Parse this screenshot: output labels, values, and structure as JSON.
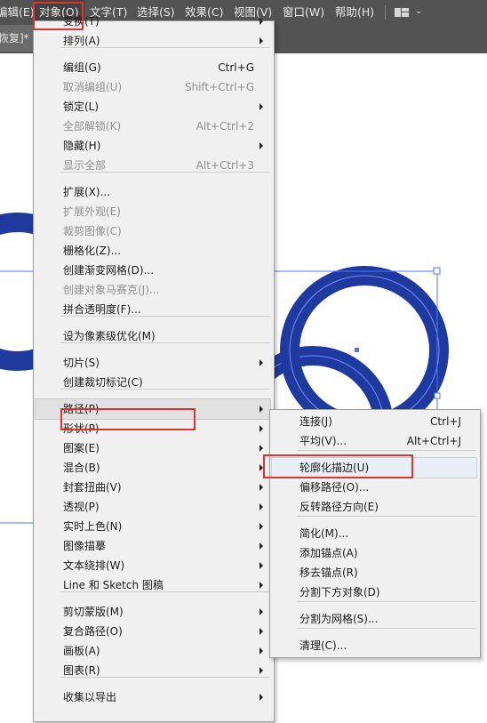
{
  "menubar": {
    "items": [
      "编辑(E)",
      "对象(O)",
      "文字(T)",
      "选择(S)",
      "效果(C)",
      "视图(V)",
      "窗口(W)",
      "帮助(H)"
    ],
    "workspace_icon": "workspace-layout-icon",
    "workspace_chevron": "⌄"
  },
  "document_tab": {
    "title": "恢复]*"
  },
  "object_menu": {
    "items": [
      {
        "label": "变换(T)",
        "shortcut": "",
        "submenu": true,
        "disabled": false
      },
      {
        "label": "排列(A)",
        "shortcut": "",
        "submenu": true,
        "disabled": false
      },
      {
        "label": "编组(G)",
        "shortcut": "Ctrl+G",
        "submenu": false,
        "disabled": false
      },
      {
        "label": "取消编组(U)",
        "shortcut": "Shift+Ctrl+G",
        "submenu": false,
        "disabled": true
      },
      {
        "label": "锁定(L)",
        "shortcut": "",
        "submenu": true,
        "disabled": false
      },
      {
        "label": "全部解锁(K)",
        "shortcut": "Alt+Ctrl+2",
        "submenu": false,
        "disabled": true
      },
      {
        "label": "隐藏(H)",
        "shortcut": "",
        "submenu": true,
        "disabled": false
      },
      {
        "label": "显示全部",
        "shortcut": "Alt+Ctrl+3",
        "submenu": false,
        "disabled": true
      },
      {
        "label": "扩展(X)...",
        "shortcut": "",
        "submenu": false,
        "disabled": false
      },
      {
        "label": "扩展外观(E)",
        "shortcut": "",
        "submenu": false,
        "disabled": true
      },
      {
        "label": "裁剪图像(C)",
        "shortcut": "",
        "submenu": false,
        "disabled": true
      },
      {
        "label": "栅格化(Z)...",
        "shortcut": "",
        "submenu": false,
        "disabled": false
      },
      {
        "label": "创建渐变网格(D)...",
        "shortcut": "",
        "submenu": false,
        "disabled": false
      },
      {
        "label": "创建对象马赛克(J)...",
        "shortcut": "",
        "submenu": false,
        "disabled": true
      },
      {
        "label": "拼合透明度(F)...",
        "shortcut": "",
        "submenu": false,
        "disabled": false
      },
      {
        "label": "设为像素级优化(M)",
        "shortcut": "",
        "submenu": false,
        "disabled": false
      },
      {
        "label": "切片(S)",
        "shortcut": "",
        "submenu": true,
        "disabled": false
      },
      {
        "label": "创建裁切标记(C)",
        "shortcut": "",
        "submenu": false,
        "disabled": false
      },
      {
        "label": "路径(P)",
        "shortcut": "",
        "submenu": true,
        "disabled": false,
        "highlighted": true
      },
      {
        "label": "形状(P)",
        "shortcut": "",
        "submenu": true,
        "disabled": false
      },
      {
        "label": "图案(E)",
        "shortcut": "",
        "submenu": true,
        "disabled": false
      },
      {
        "label": "混合(B)",
        "shortcut": "",
        "submenu": true,
        "disabled": false
      },
      {
        "label": "封套扭曲(V)",
        "shortcut": "",
        "submenu": true,
        "disabled": false
      },
      {
        "label": "透视(P)",
        "shortcut": "",
        "submenu": true,
        "disabled": false
      },
      {
        "label": "实时上色(N)",
        "shortcut": "",
        "submenu": true,
        "disabled": false
      },
      {
        "label": "图像描摹",
        "shortcut": "",
        "submenu": true,
        "disabled": false
      },
      {
        "label": "文本绕排(W)",
        "shortcut": "",
        "submenu": true,
        "disabled": false
      },
      {
        "label": "Line 和 Sketch 图稿",
        "shortcut": "",
        "submenu": true,
        "disabled": false
      },
      {
        "label": "剪切蒙版(M)",
        "shortcut": "",
        "submenu": true,
        "disabled": false
      },
      {
        "label": "复合路径(O)",
        "shortcut": "",
        "submenu": true,
        "disabled": false
      },
      {
        "label": "画板(A)",
        "shortcut": "",
        "submenu": true,
        "disabled": false
      },
      {
        "label": "图表(R)",
        "shortcut": "",
        "submenu": true,
        "disabled": false
      },
      {
        "label": "收集以导出",
        "shortcut": "",
        "submenu": true,
        "disabled": false
      }
    ]
  },
  "path_submenu": {
    "items": [
      {
        "label": "连接(J)",
        "shortcut": "Ctrl+J"
      },
      {
        "label": "平均(V)...",
        "shortcut": "Alt+Ctrl+J"
      },
      {
        "label": "轮廓化描边(U)",
        "shortcut": "",
        "highlighted": true
      },
      {
        "label": "偏移路径(O)...",
        "shortcut": ""
      },
      {
        "label": "反转路径方向(E)",
        "shortcut": ""
      },
      {
        "label": "简化(M)...",
        "shortcut": ""
      },
      {
        "label": "添加锚点(A)",
        "shortcut": ""
      },
      {
        "label": "移去锚点(R)",
        "shortcut": ""
      },
      {
        "label": "分割下方对象(D)",
        "shortcut": ""
      },
      {
        "label": "分割为网格(S)...",
        "shortcut": ""
      },
      {
        "label": "清理(C)...",
        "shortcut": ""
      }
    ]
  },
  "colors": {
    "menubar_bg": "#535353",
    "ring_fill": "#1f3a9e",
    "selection": "#4a78ff",
    "callout_red": "#e2322f"
  }
}
